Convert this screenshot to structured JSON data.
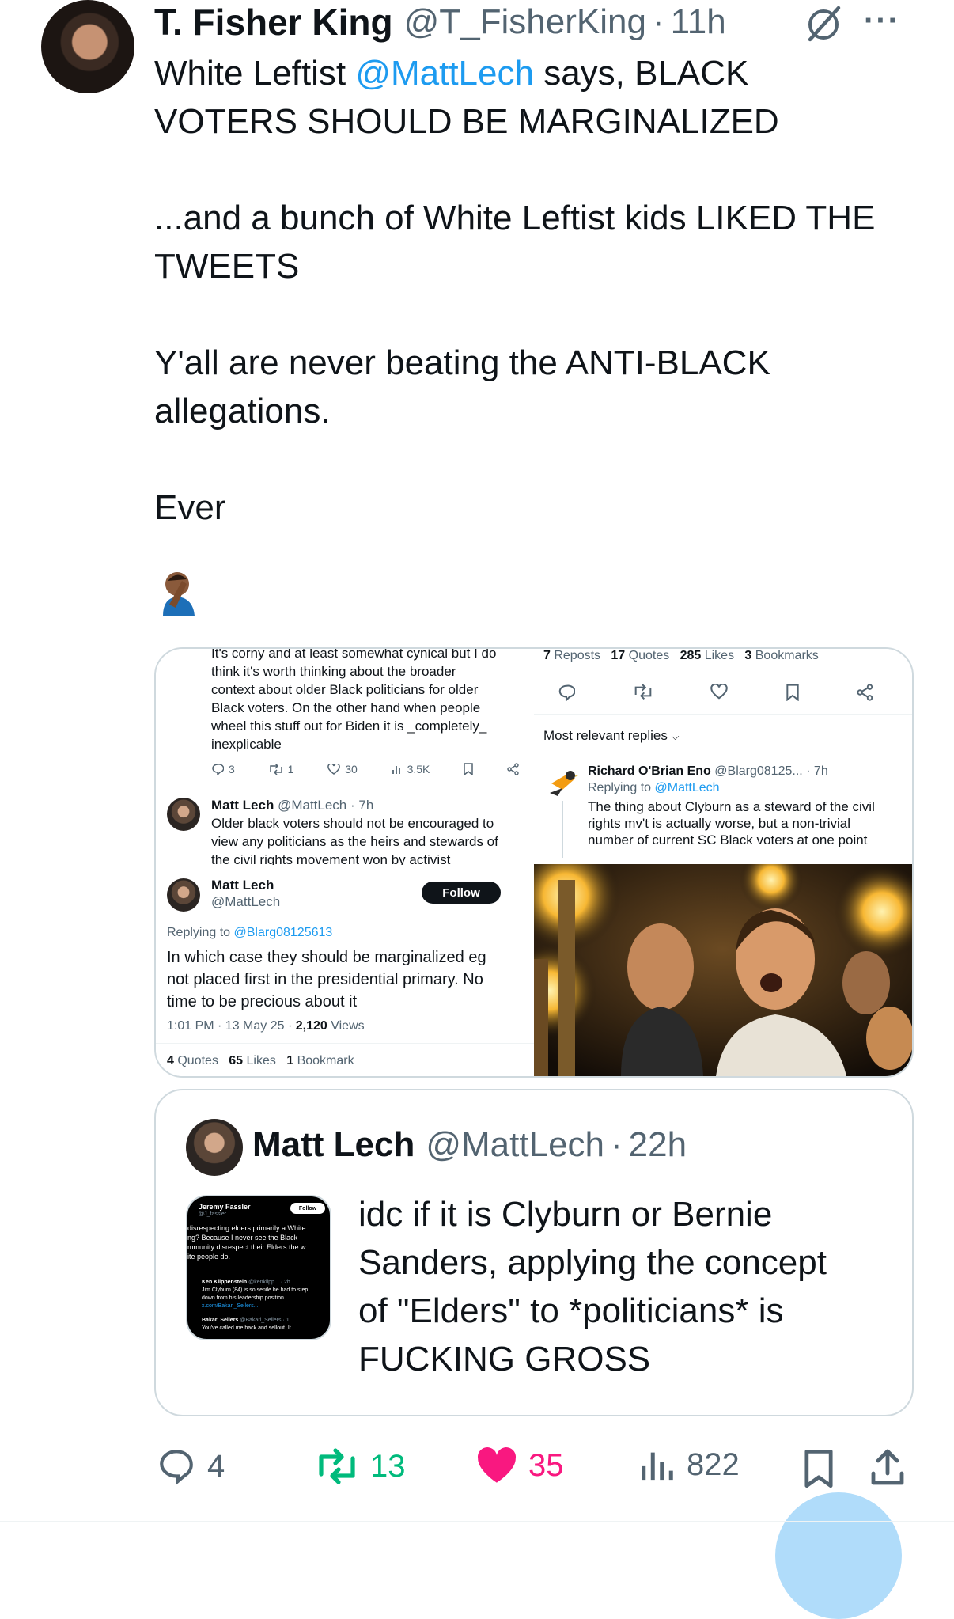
{
  "header": {
    "name": "T. Fisher King",
    "handle": "@T_FisherKing",
    "separator": "·",
    "time": "11h",
    "more_label": "···"
  },
  "post": {
    "line1_a": "White Leftist ",
    "line1_mention": "@MattLech",
    "line1_b": " says, BLACK",
    "line2": "VOTERS SHOULD BE MARGINALIZED",
    "para2_l1": "...and a bunch of White Leftist kids LIKED THE",
    "para2_l2": "TWEETS",
    "para3_l1": "Y'all are never beating the ANTI-BLACK",
    "para3_l2": "allegations.",
    "para4": "Ever",
    "emoji": "🤦🏾‍♂️"
  },
  "media_left": {
    "top_text_l0": "It's corny and at least somewhat cynical but I do",
    "top_text_l1": "think it's worth thinking about the broader",
    "top_text_l2": "context about older Black politicians for older",
    "top_text_l3": "Black voters. On the other hand when people",
    "top_text_l4": "wheel this stuff out for Biden it is _completely_",
    "top_text_l5": "inexplicable",
    "metrics": {
      "replies": "3",
      "reposts": "1",
      "likes": "30",
      "views": "3.5K"
    },
    "reply1": {
      "name": "Matt Lech",
      "handle": "@MattLech · 7h",
      "l1": "Older black voters should not be encouraged to",
      "l2": "view any politicians as the heirs and stewards of",
      "l3": "the civil rights movement won by activist"
    },
    "main": {
      "name": "Matt Lech",
      "handle": "@MattLech",
      "follow": "Follow",
      "replying_prefix": "Replying to ",
      "replying_handle": "@Blarg08125613",
      "l1": "In which case they should be marginalized eg",
      "l2": "not placed first in the presidential primary. No",
      "l3": "time to be precious about it",
      "meta_time": "1:01 PM · 13 May 25 · ",
      "meta_views": "2,120",
      "meta_views_label": " Views"
    },
    "stats": {
      "quotes_n": "4",
      "quotes_l": " Quotes",
      "likes_n": "65",
      "likes_l": " Likes",
      "bookmarks_n": "1",
      "bookmarks_l": " Bookmark"
    }
  },
  "media_right": {
    "stats": {
      "reposts_n": "7",
      "reposts_l": " Reposts",
      "quotes_n": "17",
      "quotes_l": " Quotes",
      "likes_n": "285",
      "likes_l": " Likes",
      "bookmarks_n": "3",
      "bookmarks_l": " Bookmarks"
    },
    "most_relevant": "Most relevant replies",
    "reply": {
      "name": "Richard O'Brian Eno",
      "handle": "@Blarg08125... · 7h",
      "replying_prefix": "Replying to ",
      "replying_handle": "@MattLech",
      "l1": "The thing about Clyburn as a steward of the civil",
      "l2": "rights mv't is actually worse, but a non-trivial",
      "l3": "number of current SC Black voters at one point"
    }
  },
  "quote": {
    "name": "Matt Lech",
    "handle": "@MattLech",
    "separator": "·",
    "time": "22h",
    "l1": "idc if it is Clyburn or Bernie",
    "l2": "Sanders, applying the concept",
    "l3": "of \"Elders\" to *politicians* is",
    "l4": "FUCKING GROSS",
    "thumb": {
      "name": "Jeremy Fassler",
      "handle": "@J_fassler",
      "follow": "Follow",
      "t1": "disrespecting elders primarily a White",
      "t2": "ng? Because I never see the Black",
      "t3": "mmunity disrespect their Elders the w",
      "t4": "ite people do.",
      "r_name": "Ken Klippenstein",
      "r_handle": "@kenklipp... · 2h",
      "r1": "Jim Clyburn (84) is so senile he had to step",
      "r2": "down from his leadership position",
      "r3": "x.com/Bakari_Sellers...",
      "s_name": "Bakari Sellers",
      "s_handle": "@Bakari_Sellers · 1",
      "s1": "You've called me hack and sellout. It"
    }
  },
  "actions": {
    "replies": "4",
    "reposts": "13",
    "likes": "35",
    "views": "822"
  },
  "colors": {
    "accent": "#1d9bf0",
    "repost_green": "#00ba7c",
    "like_pink": "#f91880",
    "text": "#0f1419",
    "muted": "#536471"
  }
}
